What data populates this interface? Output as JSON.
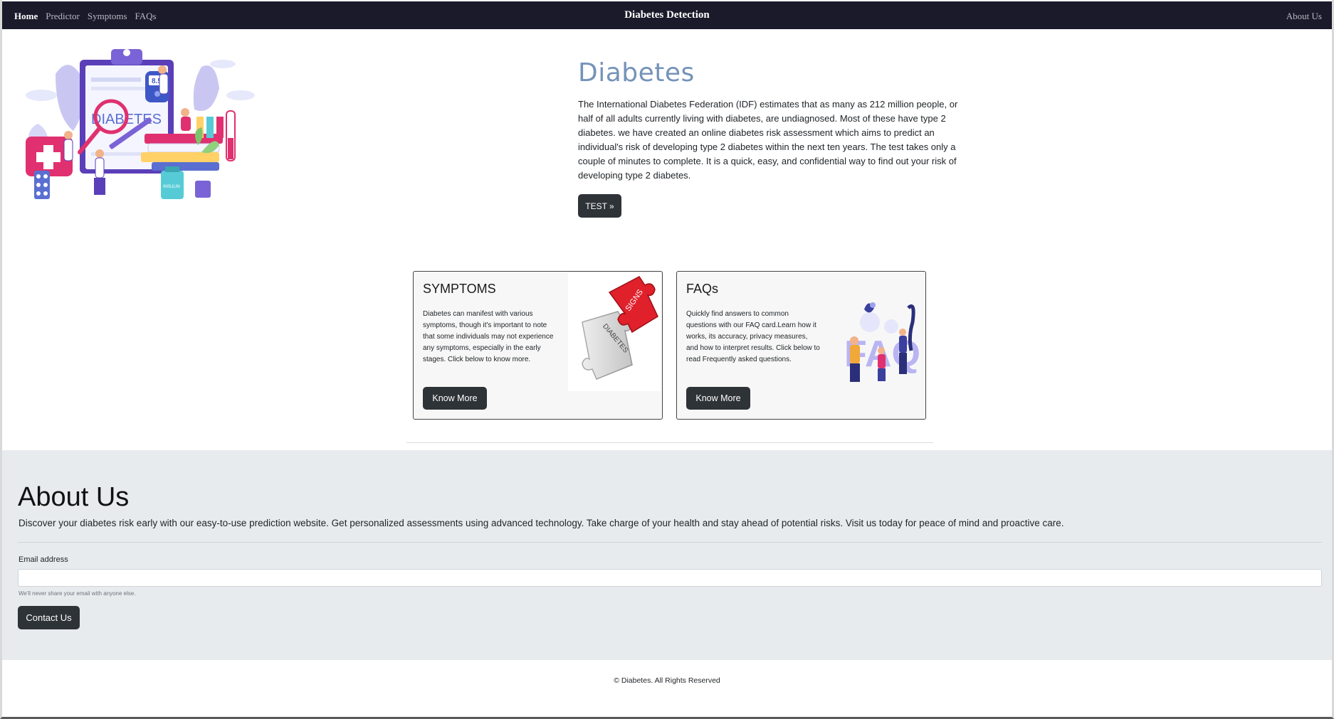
{
  "nav": {
    "links": [
      "Home",
      "Predictor",
      "Symptoms",
      "FAQs"
    ],
    "brand": "Diabetes Detection",
    "right_link": "About Us"
  },
  "hero": {
    "title": "Diabetes",
    "illustration_text": "DIABETES",
    "meter_reading": "8.5",
    "insulin_label": "INSULIN",
    "paragraph": "The International Diabetes Federation (IDF) estimates that as many as 212 million people, or half of all adults currently living with diabetes, are undiagnosed. Most of these have type 2 diabetes. we have created an online diabetes risk assessment which aims to predict an individual's risk of developing type 2 diabetes within the next ten years. The test takes only a couple of minutes to complete. It is a quick, easy, and confidential way to find out your risk of developing type 2 diabetes.",
    "button": "TEST »"
  },
  "cards": {
    "symptoms": {
      "title": "SYMPTOMS",
      "body": "Diabetes can manifest with various symptoms, though it's important to note that some individuals may not experience any symptoms, especially in the early stages. Click below to know more.",
      "button": "Know More",
      "puzzle_text_red": "SIGNS",
      "puzzle_text_white": "DIABETES"
    },
    "faqs": {
      "title": "FAQs",
      "body": "Quickly find answers to common questions with our FAQ card.Learn how it works, its accuracy, privacy measures, and how to interpret results. Click below to read Frequently asked questions.",
      "button": "Know More",
      "image_text": "FAQ"
    }
  },
  "about": {
    "title": "About Us",
    "paragraph": "Discover your diabetes risk early with our easy-to-use prediction website. Get personalized assessments using advanced technology. Take charge of your health and stay ahead of potential risks. Visit us today for peace of mind and proactive care.",
    "email_label": "Email address",
    "email_value": "",
    "email_help": "We'll never share your email with anyone else.",
    "button": "Contact Us"
  },
  "footer": {
    "text": "© Diabetes. All Rights Reserved"
  },
  "colors": {
    "navbar": "#1a1a2b",
    "hero_title": "#7493b9",
    "button": "#2e3338",
    "about_bg": "#e8ebee"
  }
}
